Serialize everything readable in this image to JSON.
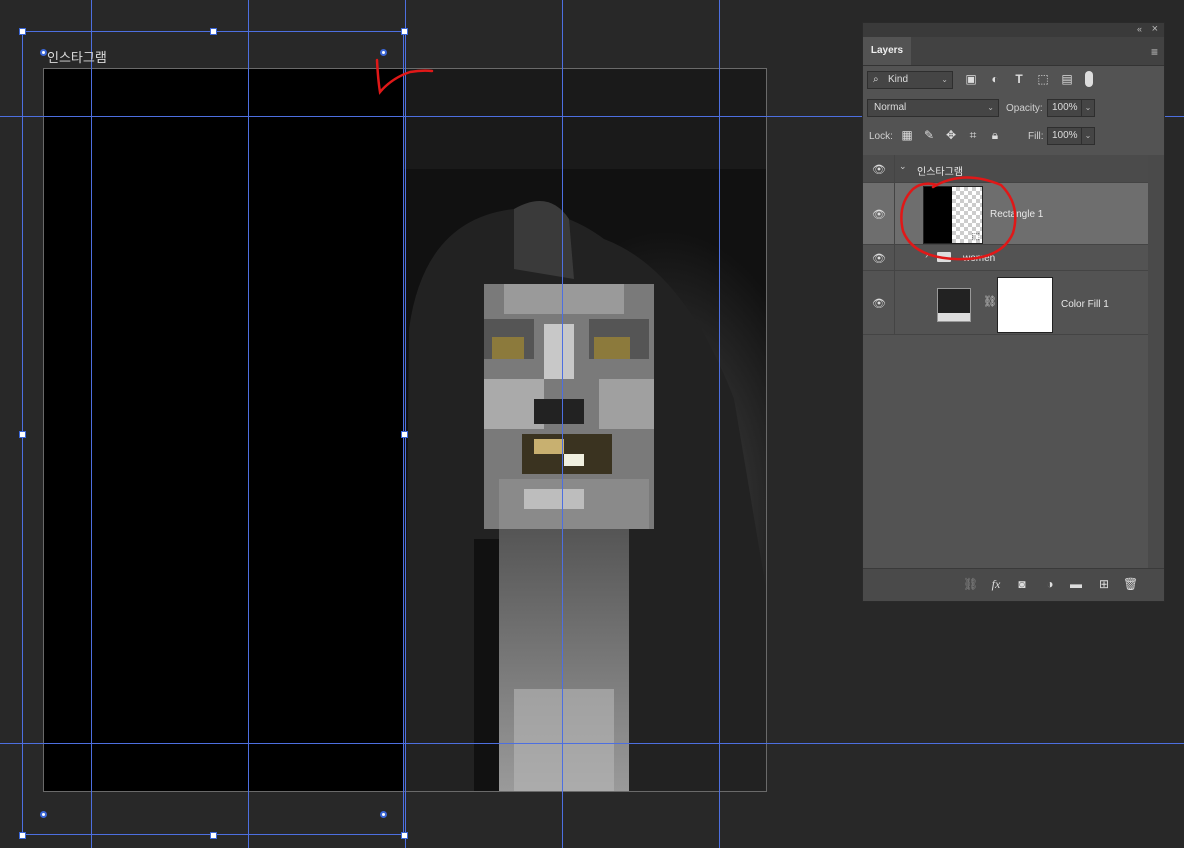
{
  "canvas": {
    "artboard_label": "인스타그램"
  },
  "layers_panel": {
    "tab_label": "Layers",
    "collapse_icon": "double-chevron-icon",
    "close_icon": "close-icon",
    "filter_kind": "Kind",
    "blend_mode": "Normal",
    "opacity_label": "Opacity:",
    "opacity_value": "100%",
    "lock_label": "Lock:",
    "fill_label": "Fill:",
    "fill_value": "100%",
    "layers": [
      {
        "name": "인스타그램",
        "type": "artboard",
        "visible": true
      },
      {
        "name": "Rectangle 1",
        "type": "shape",
        "visible": true,
        "selected": true
      },
      {
        "name": "women",
        "type": "group",
        "visible": true
      },
      {
        "name": "Color Fill 1",
        "type": "fill",
        "visible": true
      }
    ]
  },
  "annotation_color": "#e01818",
  "guide_color": "#4d6fe0"
}
